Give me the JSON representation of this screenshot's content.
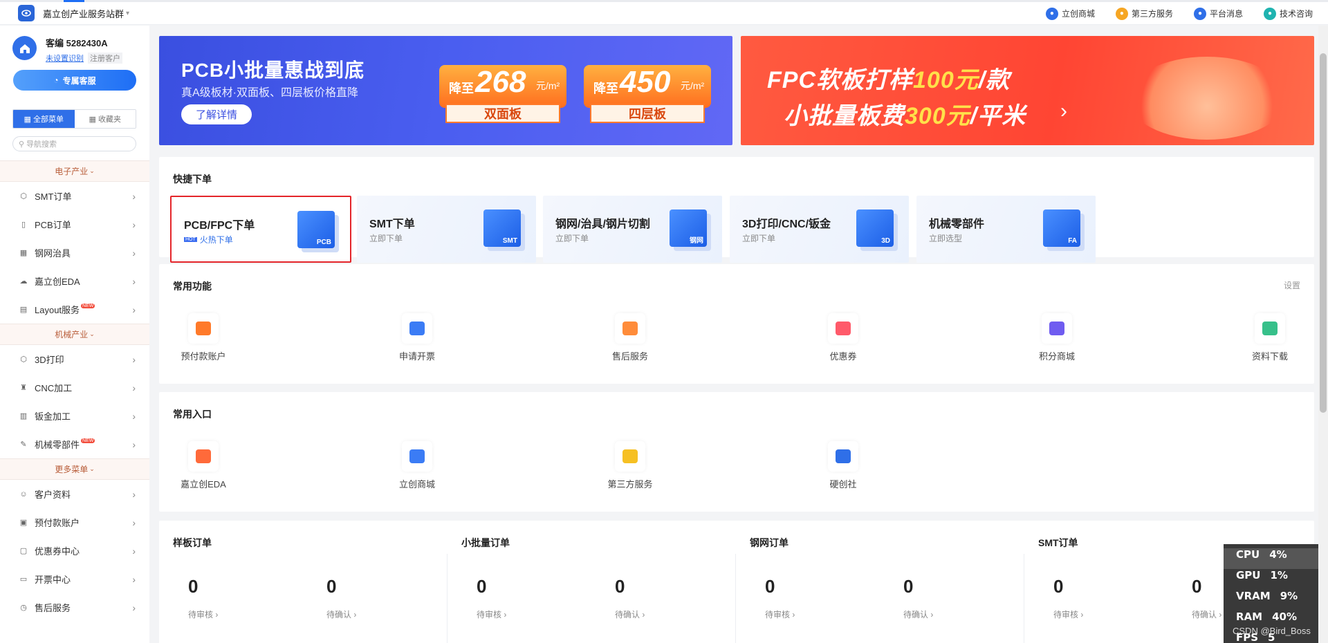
{
  "topbar": {
    "brand": "嘉立创产业服务站群",
    "links": [
      {
        "label": "立创商城",
        "icon": "shop-icon",
        "color": "#2f6fe8"
      },
      {
        "label": "第三方服务",
        "icon": "grid-icon",
        "color": "#f6a623"
      },
      {
        "label": "平台消息",
        "icon": "bell-icon",
        "color": "#2f6fe8"
      },
      {
        "label": "技术咨询",
        "icon": "chat-icon",
        "color": "#1fb3b0"
      }
    ]
  },
  "sidebar": {
    "user": {
      "name": "客编 5282430A",
      "link": "未设置识别",
      "tag": "注册客户"
    },
    "service_btn": "专属客服",
    "tabs": {
      "all": "全部菜单",
      "favorites": "收藏夹"
    },
    "search_placeholder": "导航搜索",
    "sections": [
      {
        "title": "电子产业",
        "items": [
          {
            "label": "SMT订单",
            "icon": "cube-icon"
          },
          {
            "label": "PCB订单",
            "icon": "board-icon"
          },
          {
            "label": "钢网治具",
            "icon": "grid-icon"
          },
          {
            "label": "嘉立创EDA",
            "icon": "cloud-icon"
          },
          {
            "label": "Layout服务",
            "icon": "layout-icon",
            "badge": "NEW"
          }
        ]
      },
      {
        "title": "机械产业",
        "items": [
          {
            "label": "3D打印",
            "icon": "cube-icon"
          },
          {
            "label": "CNC加工",
            "icon": "drill-icon"
          },
          {
            "label": "钣金加工",
            "icon": "sheet-icon"
          },
          {
            "label": "机械零部件",
            "icon": "wrench-icon",
            "badge": "NEW"
          }
        ]
      },
      {
        "title": "更多菜单",
        "items": [
          {
            "label": "客户资料",
            "icon": "user-icon"
          },
          {
            "label": "预付款账户",
            "icon": "wallet-icon"
          },
          {
            "label": "优惠券中心",
            "icon": "coupon-icon"
          },
          {
            "label": "开票中心",
            "icon": "invoice-icon"
          },
          {
            "label": "售后服务",
            "icon": "service-icon"
          }
        ]
      }
    ]
  },
  "banner1": {
    "title": "PCB小批量惠战到底",
    "subtitle": "真A级板材·双面板、四层板价格直降",
    "button": "了解详情",
    "offers": [
      {
        "prefix": "降至",
        "price": "268",
        "unit": "元/m²",
        "label": "双面板"
      },
      {
        "prefix": "降至",
        "price": "450",
        "unit": "元/m²",
        "label": "四层板"
      }
    ]
  },
  "banner2": {
    "line1_a": "FPC软板打样",
    "line1_hl": "100元",
    "line1_b": "/款",
    "line2_a": "小批量板费",
    "line2_hl": "300元",
    "line2_b": "/平米"
  },
  "quick": {
    "title": "快捷下单",
    "cards": [
      {
        "title": "PCB/FPC下单",
        "sub": "火热下单",
        "hot": "HOT",
        "icon_text": "PCB",
        "active": true
      },
      {
        "title": "SMT下单",
        "sub": "立即下单",
        "icon_text": "SMT"
      },
      {
        "title": "钢网/治具/钢片切割",
        "sub": "立即下单",
        "icon_text": "钢网"
      },
      {
        "title": "3D打印/CNC/钣金",
        "sub": "立即下单",
        "icon_text": "3D"
      },
      {
        "title": "机械零部件",
        "sub": "立即选型",
        "icon_text": "FA"
      }
    ]
  },
  "common": {
    "title": "常用功能",
    "settings": "设置",
    "items": [
      {
        "label": "预付款账户",
        "color": "#ff7a2a"
      },
      {
        "label": "申请开票",
        "color": "#3b7cf5"
      },
      {
        "label": "售后服务",
        "color": "#ff8c3a"
      },
      {
        "label": "优惠券",
        "color": "#ff5a6a"
      },
      {
        "label": "积分商城",
        "color": "#6f5cf0"
      },
      {
        "label": "资料下载",
        "color": "#37c08a"
      }
    ]
  },
  "entry": {
    "title": "常用入口",
    "items": [
      {
        "label": "嘉立创EDA",
        "color": "#ff6a3a"
      },
      {
        "label": "立创商城",
        "color": "#3b7cf5"
      },
      {
        "label": "第三方服务",
        "color": "#f6c023"
      },
      {
        "label": "硬创社",
        "color": "#2f6fe8"
      }
    ]
  },
  "orders": [
    {
      "title": "样板订单",
      "a_num": "0",
      "a_lbl": "待审核 ›",
      "b_num": "0",
      "b_lbl": "待确认 ›"
    },
    {
      "title": "小批量订单",
      "a_num": "0",
      "a_lbl": "待审核 ›",
      "b_num": "0",
      "b_lbl": "待确认 ›"
    },
    {
      "title": "钢网订单",
      "a_num": "0",
      "a_lbl": "待审核 ›",
      "b_num": "0",
      "b_lbl": "待确认 ›"
    },
    {
      "title": "SMT订单",
      "a_num": "0",
      "a_lbl": "待审核 ›",
      "b_num": "0",
      "b_lbl": "待确认 ›"
    }
  ],
  "perf": [
    {
      "k": "CPU",
      "v": "4%"
    },
    {
      "k": "GPU",
      "v": "1%"
    },
    {
      "k": "VRAM",
      "v": "9%"
    },
    {
      "k": "RAM",
      "v": "40%"
    },
    {
      "k": "FPS",
      "v": "5"
    }
  ],
  "watermark": "CSDN @Bird_Boss"
}
